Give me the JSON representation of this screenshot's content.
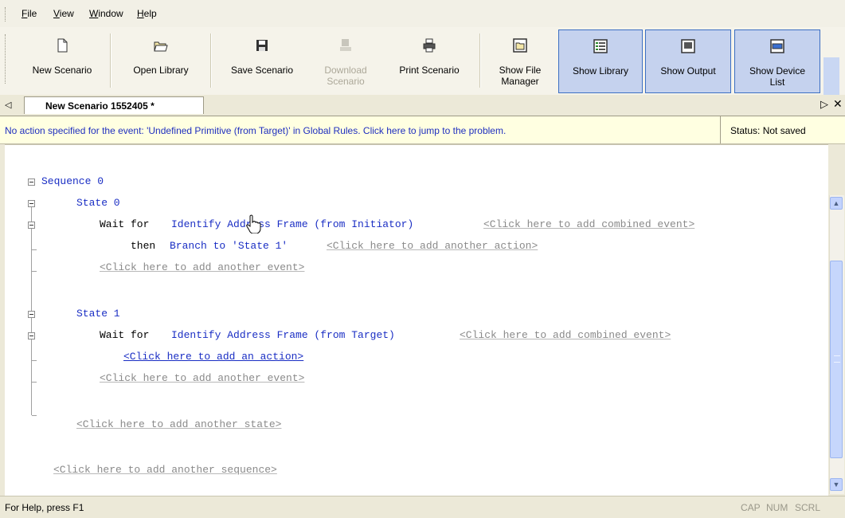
{
  "menu": {
    "file": "File",
    "view": "View",
    "window": "Window",
    "help": "Help"
  },
  "toolbar": {
    "new_scenario": "New Scenario",
    "open_library": "Open Library",
    "save_scenario": "Save Scenario",
    "download_scenario_1": "Download",
    "download_scenario_2": "Scenario",
    "print_scenario": "Print Scenario",
    "show_file_manager_1": "Show File",
    "show_file_manager_2": "Manager",
    "show_library": "Show Library",
    "show_output": "Show Output",
    "show_device_list_1": "Show Device",
    "show_device_list_2": "List"
  },
  "tab": {
    "title": "New Scenario 1552405 *"
  },
  "message": {
    "text": "No action specified for the event: 'Undefined Primitive (from Target)' in Global Rules.  Click here to jump to the problem.",
    "status": "Status: Not saved"
  },
  "script": {
    "sequence_0": "Sequence 0",
    "state_0": "State 0",
    "wait_for_1": "Wait for",
    "event_1": "Identify Address Frame (from Initiator)",
    "add_combined_event_1": "<Click here to add combined event>",
    "then": "then",
    "action_1": "Branch to 'State 1'",
    "add_another_action": "<Click here to add another action>",
    "add_another_event_1": "<Click here to add another event>",
    "state_1": "State 1",
    "wait_for_2": "Wait for",
    "event_2": "Identify Address Frame (from Target)",
    "add_combined_event_2": "<Click here to add combined event>",
    "add_an_action": "<Click here to add an action>",
    "add_another_event_2": "<Click here to add another event>",
    "add_another_state": "<Click here to add another state>",
    "add_another_sequence": "<Click here to add another sequence>"
  },
  "statusbar": {
    "help": "For Help, press F1",
    "cap": "CAP",
    "num": "NUM",
    "scrl": "SCRL"
  },
  "colors": {
    "keyword": "#1a2ec4",
    "placeholder": "#8a8a8a",
    "message": "#1f2fbf",
    "active_button": "#c5d2ee"
  },
  "icons": [
    "new-document-icon",
    "open-folder-icon",
    "save-disk-icon",
    "download-icon",
    "printer-icon",
    "file-manager-icon",
    "library-icon",
    "output-icon",
    "device-list-icon",
    "hand-cursor-icon"
  ]
}
